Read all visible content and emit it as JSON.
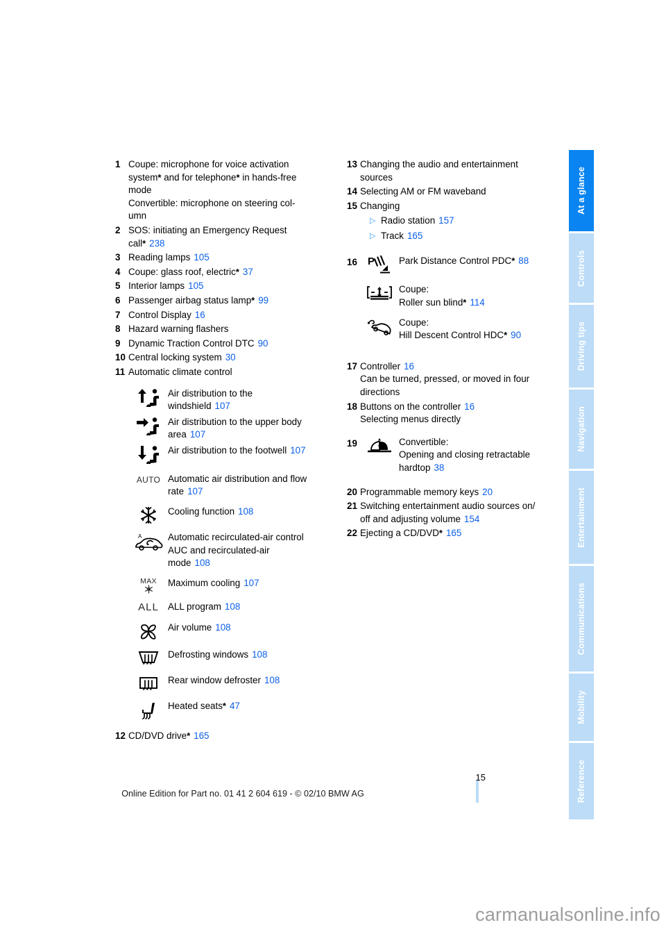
{
  "page": {
    "number": "15",
    "footer_text": "Online Edition for Part no. 01 41 2 604 619 - © 02/10 BMW AG",
    "watermark": "carmanualsonline.info"
  },
  "colors": {
    "accent_active_tab": "#0a84f0",
    "tab_inactive": "#bcdcf7",
    "page_reference": "#0b5fe8",
    "bullet": "#2f9bf0"
  },
  "tabs": [
    {
      "label": "At a glance",
      "active": true
    },
    {
      "label": "Controls",
      "active": false
    },
    {
      "label": "Driving tips",
      "active": false
    },
    {
      "label": "Navigation",
      "active": false
    },
    {
      "label": "Entertainment",
      "active": false
    },
    {
      "label": "Communications",
      "active": false
    },
    {
      "label": "Mobility",
      "active": false
    },
    {
      "label": "Reference",
      "active": false
    }
  ],
  "left_column": {
    "entries": [
      {
        "num": "1",
        "lines": [
          "Coupe: microphone for voice activation",
          "system* and for telephone* in hands-free",
          "mode",
          "Convertible: microphone on steering col-",
          "umn"
        ]
      },
      {
        "num": "2",
        "lines": [
          "SOS: initiating an Emergency Request",
          "call*"
        ],
        "ref": "238"
      },
      {
        "num": "3",
        "lines": [
          "Reading lamps"
        ],
        "ref": "105"
      },
      {
        "num": "4",
        "lines": [
          "Coupe: glass roof, electric*"
        ],
        "ref": "37"
      },
      {
        "num": "5",
        "lines": [
          "Interior lamps"
        ],
        "ref": "105"
      },
      {
        "num": "6",
        "lines": [
          "Passenger airbag status lamp*"
        ],
        "ref": "99"
      },
      {
        "num": "7",
        "lines": [
          "Control Display"
        ],
        "ref": "16"
      },
      {
        "num": "8",
        "lines": [
          "Hazard warning flashers"
        ],
        "ref": ""
      },
      {
        "num": "9",
        "lines": [
          "Dynamic Traction Control DTC"
        ],
        "ref": "90"
      },
      {
        "num": "10",
        "lines": [
          "Central locking system"
        ],
        "ref": "30"
      },
      {
        "num": "11",
        "lines": [
          "Automatic climate control"
        ],
        "ref": ""
      }
    ],
    "climate_icons": [
      {
        "icon": "air-distribution-windshield-icon",
        "lines": [
          "Air distribution to the",
          "windshield"
        ],
        "ref": "107"
      },
      {
        "icon": "air-distribution-upper-body-icon",
        "lines": [
          "Air distribution to the upper body",
          "area"
        ],
        "ref": "107"
      },
      {
        "icon": "air-distribution-footwell-icon",
        "lines": [
          "Air distribution to the footwell"
        ],
        "ref": "107"
      },
      {
        "icon": "auto-climate-icon",
        "icon_text": "AUTO",
        "lines": [
          "Automatic air distribution and flow",
          "rate"
        ],
        "ref": "107"
      },
      {
        "icon": "cooling-snowflake-icon",
        "lines": [
          "Cooling function"
        ],
        "ref": "108"
      },
      {
        "icon": "auc-recirculated-air-icon",
        "lines": [
          "Automatic recirculated-air control",
          "AUC and recirculated-air",
          "mode"
        ],
        "ref": "108"
      },
      {
        "icon": "max-cooling-icon",
        "icon_text": "MAX",
        "lines": [
          "Maximum cooling"
        ],
        "ref": "107"
      },
      {
        "icon": "all-program-icon",
        "icon_text": "ALL",
        "lines": [
          "ALL program"
        ],
        "ref": "108"
      },
      {
        "icon": "fan-air-volume-icon",
        "lines": [
          "Air volume"
        ],
        "ref": "108"
      },
      {
        "icon": "defrost-windshield-icon",
        "lines": [
          "Defrosting windows"
        ],
        "ref": "108"
      },
      {
        "icon": "rear-window-defroster-icon",
        "lines": [
          "Rear window defroster"
        ],
        "ref": "108"
      },
      {
        "icon": "heated-seats-icon",
        "lines": [
          "Heated seats*"
        ],
        "ref": "47"
      }
    ],
    "trailing_entries": [
      {
        "num": "12",
        "lines": [
          "CD/DVD drive*"
        ],
        "ref": "165"
      }
    ]
  },
  "right_column": {
    "entries": [
      {
        "num": "13",
        "lines": [
          "Changing the audio and entertainment",
          "sources"
        ],
        "ref": ""
      },
      {
        "num": "14",
        "lines": [
          "Selecting AM or FM waveband"
        ],
        "ref": ""
      },
      {
        "num": "15",
        "lines": [
          "Changing"
        ],
        "ref": "",
        "subs": [
          {
            "text": "Radio station",
            "ref": "157"
          },
          {
            "text": "Track",
            "ref": "165"
          }
        ]
      }
    ],
    "item16": {
      "num": "16",
      "icons": [
        {
          "icon": "park-distance-control-icon",
          "lines": [
            "Park Distance Control PDC*"
          ],
          "ref": "88"
        },
        {
          "icon": "roller-sun-blind-icon",
          "lines": [
            "Coupe:",
            "Roller sun blind*"
          ],
          "ref": "114"
        },
        {
          "icon": "hill-descent-control-icon",
          "lines": [
            "Coupe:",
            "Hill Descent Control HDC*"
          ],
          "ref": "90"
        }
      ]
    },
    "entries2": [
      {
        "num": "17",
        "lines": [
          "Controller",
          "Can be turned, pressed, or moved in four",
          "directions"
        ],
        "ref_on_line": 0,
        "ref": "16"
      },
      {
        "num": "18",
        "lines": [
          "Buttons on the controller",
          "Selecting menus directly"
        ],
        "ref_on_line": 0,
        "ref": "16"
      }
    ],
    "item19": {
      "num": "19",
      "icon": "retractable-hardtop-icon",
      "lines": [
        "Convertible:",
        "Opening and closing retractable",
        "hardtop"
      ],
      "ref": "38"
    },
    "entries3": [
      {
        "num": "20",
        "lines": [
          "Programmable memory keys"
        ],
        "ref": "20"
      },
      {
        "num": "21",
        "lines": [
          "Switching entertainment audio sources on/",
          "off and adjusting volume"
        ],
        "ref": "154"
      },
      {
        "num": "22",
        "lines": [
          "Ejecting a CD/DVD*"
        ],
        "ref": "165"
      }
    ]
  }
}
